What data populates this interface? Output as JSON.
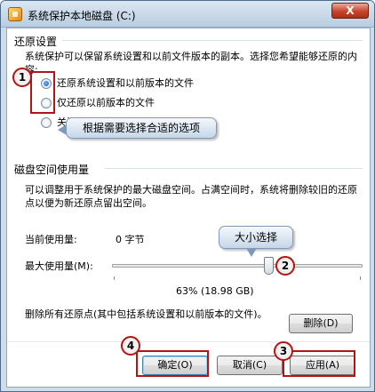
{
  "window": {
    "title": "系统保护本地磁盘 (C:)",
    "close_label": "X"
  },
  "restore": {
    "group_title": "还原设置",
    "description": "系统保护可以保留系统设置和以前文件版本的副本。选择您希望能够还原的内容:",
    "options": [
      {
        "label": "还原系统设置和以前版本的文件",
        "checked": true
      },
      {
        "label": "仅还原以前版本的文件",
        "checked": false
      },
      {
        "label": "关闭系统保护",
        "checked": false
      }
    ]
  },
  "disk": {
    "group_title": "磁盘空间使用量",
    "description": "可以调整用于系统保护的最大磁盘空间。占满空间时，系统将删除较旧的还原点以便为新还原点留出空间。",
    "current_label": "当前使用量:",
    "current_value": "0 字节",
    "max_label": "最大使用量(M):",
    "max_fraction": 0.63,
    "max_value": "63% (18.98 GB)"
  },
  "delete": {
    "description": "删除所有还原点(其中包括系统设置和以前版本的文件)。",
    "button_label": "删除(D)"
  },
  "footer": {
    "ok_label": "确定(O)",
    "cancel_label": "取消(C)",
    "apply_label": "应用(A)"
  },
  "annotations": {
    "callout_options": "根据需要选择合适的选项",
    "callout_size": "大小选择",
    "markers": [
      "1",
      "2",
      "3",
      "4"
    ]
  },
  "colors": {
    "annotation_red": "#b11515",
    "title_bar": "#cfdde9"
  }
}
